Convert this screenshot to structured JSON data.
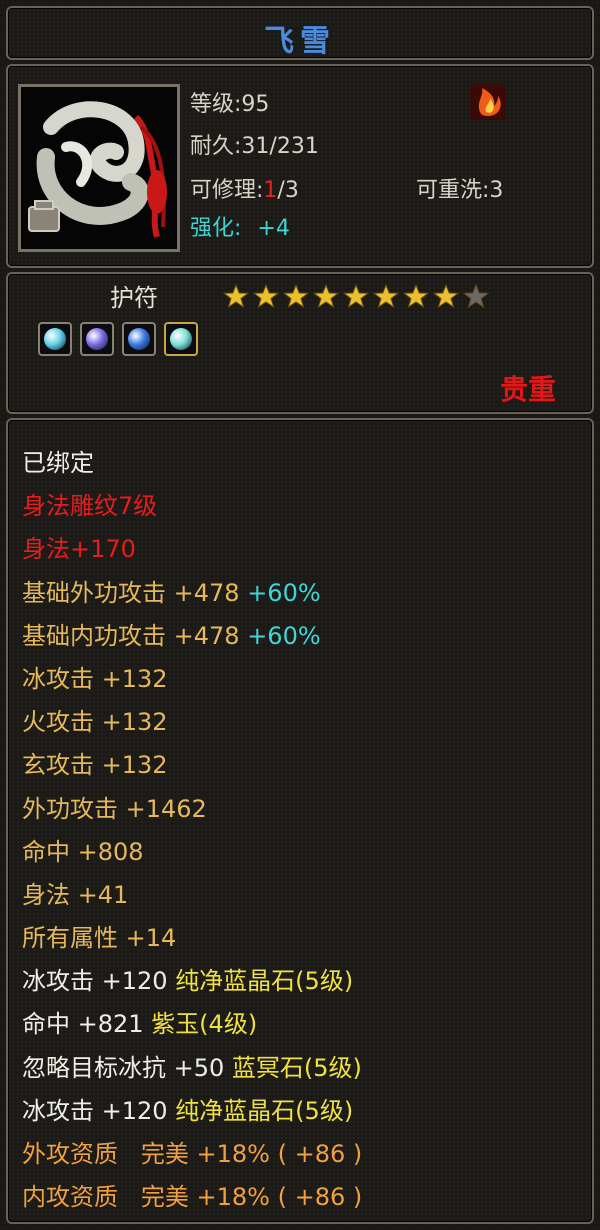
{
  "item": {
    "name": "飞雪",
    "level_text": "等级:95",
    "durability_label": "耐久:31/231",
    "repair_label": "可修理:",
    "repair_current": "1",
    "repair_max": "/3",
    "reroll_label": "可重洗:3",
    "enhance_label": "强化:",
    "enhance_value": "+4",
    "type": "护符",
    "stars_filled": 8,
    "stars_total": 9,
    "rarity": "贵重",
    "gems": [
      {
        "name": "ice-gem-icon",
        "color": "#5fd0e6",
        "frame": "gray"
      },
      {
        "name": "purple-gem-icon",
        "color": "#7a6ae0",
        "frame": "gray"
      },
      {
        "name": "blue-gem-icon",
        "color": "#3a7ae6",
        "frame": "gray"
      },
      {
        "name": "ice-gem-icon-gold",
        "color": "#7ae0d8",
        "frame": "gold"
      }
    ]
  },
  "stats": [
    {
      "parts": [
        {
          "t": "已绑定",
          "c": "white"
        }
      ]
    },
    {
      "parts": [
        {
          "t": "身法雕纹7级",
          "c": "red"
        }
      ]
    },
    {
      "parts": [
        {
          "t": "身法+170",
          "c": "red"
        }
      ]
    },
    {
      "parts": [
        {
          "t": "基础外功攻击",
          "c": "yellow"
        },
        {
          "t": " +478 ",
          "c": "yellow"
        },
        {
          "t": "+60%",
          "c": "cyan"
        }
      ]
    },
    {
      "parts": [
        {
          "t": "基础内功攻击",
          "c": "yellow"
        },
        {
          "t": " +478 ",
          "c": "yellow"
        },
        {
          "t": "+60%",
          "c": "cyan"
        }
      ]
    },
    {
      "parts": [
        {
          "t": "冰攻击",
          "c": "yellow"
        },
        {
          "t": " +132",
          "c": "yellow"
        }
      ]
    },
    {
      "parts": [
        {
          "t": "火攻击",
          "c": "yellow"
        },
        {
          "t": " +132",
          "c": "yellow"
        }
      ]
    },
    {
      "parts": [
        {
          "t": "玄攻击",
          "c": "yellow"
        },
        {
          "t": " +132",
          "c": "yellow"
        }
      ]
    },
    {
      "parts": [
        {
          "t": "外功攻击",
          "c": "yellow"
        },
        {
          "t": " +1462",
          "c": "yellow"
        }
      ]
    },
    {
      "parts": [
        {
          "t": "命中",
          "c": "yellow"
        },
        {
          "t": " +808",
          "c": "yellow"
        }
      ]
    },
    {
      "parts": [
        {
          "t": "身法",
          "c": "yellow"
        },
        {
          "t": " +41",
          "c": "yellow"
        }
      ]
    },
    {
      "parts": [
        {
          "t": "所有属性",
          "c": "yellow"
        },
        {
          "t": " +14",
          "c": "yellow"
        }
      ]
    },
    {
      "parts": [
        {
          "t": "冰攻击",
          "c": "white"
        },
        {
          "t": " +120 ",
          "c": "white"
        },
        {
          "t": "纯净蓝晶石(5级)",
          "c": "gem"
        }
      ]
    },
    {
      "parts": [
        {
          "t": "命中",
          "c": "white"
        },
        {
          "t": " +821 ",
          "c": "white"
        },
        {
          "t": "紫玉(4级)",
          "c": "gem"
        }
      ]
    },
    {
      "parts": [
        {
          "t": "忽略目标冰抗",
          "c": "white"
        },
        {
          "t": " +50 ",
          "c": "white"
        },
        {
          "t": "蓝冥石(5级)",
          "c": "gem"
        }
      ]
    },
    {
      "parts": [
        {
          "t": "冰攻击",
          "c": "white"
        },
        {
          "t": " +120 ",
          "c": "white"
        },
        {
          "t": "纯净蓝晶石(5级)",
          "c": "gem"
        }
      ]
    },
    {
      "parts": [
        {
          "t": "外攻资质",
          "c": "orange"
        },
        {
          "t": "   完美 ",
          "c": "orange"
        },
        {
          "t": "+18%",
          "c": "orange"
        },
        {
          "t": " ( +86 )",
          "c": "orange"
        }
      ]
    },
    {
      "parts": [
        {
          "t": "内攻资质",
          "c": "orange"
        },
        {
          "t": "   完美 ",
          "c": "orange"
        },
        {
          "t": "+18%",
          "c": "orange"
        },
        {
          "t": " ( +86 )",
          "c": "orange"
        }
      ]
    }
  ],
  "colors": {
    "white": "#efeee6",
    "red": "#e81c1c",
    "yellow": "#e6b85a",
    "gem": "#f0e040",
    "cyan": "#3fd6d6",
    "orange": "#f0a040",
    "title": "#4d8ad8",
    "star_filled": "#e8c030",
    "star_empty": "#6a6a6a"
  }
}
